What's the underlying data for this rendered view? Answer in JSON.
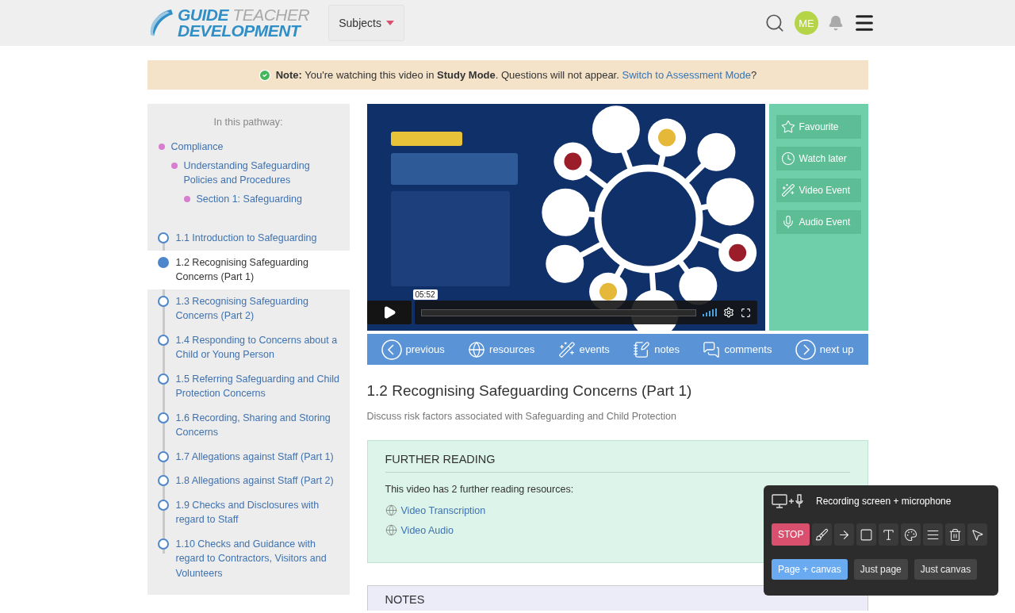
{
  "header": {
    "logo": {
      "word_1": "GUIDE",
      "word_2": "TEACHER",
      "word_3": "DEVELOPMENT"
    },
    "subjects_menu": "Subjects",
    "avatar": "ME"
  },
  "notice": {
    "text": "**Note:** You're watching this video in **Study Mode**. Questions will not appear.",
    "link": "Switch to Assessment Mode",
    "suffix": "?"
  },
  "pathway": {
    "title": "In this pathway:",
    "breadcrumbs": [
      {
        "label": "Compliance",
        "children": [
          {
            "label": "Understanding Safeguarding Policies and Procedures",
            "children": [
              {
                "label": "Section 1: Safeguarding"
              }
            ]
          }
        ]
      }
    ],
    "lessons": [
      {
        "label": "1.1 Introduction to Safeguarding",
        "selected": false
      },
      {
        "label": "1.2 Recognising Safeguarding Concerns (Part 1)",
        "selected": true
      },
      {
        "label": "1.3 Recognising Safeguarding Concerns (Part 2)",
        "selected": false
      },
      {
        "label": "1.4 Responding to Concerns about a Child or Young Person",
        "selected": false
      },
      {
        "label": "1.5 Referring Safeguarding and Child Protection Concerns",
        "selected": false
      },
      {
        "label": "1.6 Recording, Sharing and Storing Concerns",
        "selected": false
      },
      {
        "label": "1.7 Allegations against Staff (Part 1)",
        "selected": false
      },
      {
        "label": "1.8 Allegations against Staff (Part 2)",
        "selected": false
      },
      {
        "label": "1.9 Checks and Disclosures with regard to Staff",
        "selected": false
      },
      {
        "label": "1.10 Checks and Guidance with regard to Contractors, Visitors and Volunteers",
        "selected": false
      }
    ]
  },
  "video": {
    "kind": "picture",
    "time": "05:52",
    "level": 0
  },
  "video_actions": [
    {
      "kind": "star",
      "label": "Favourite"
    },
    {
      "kind": "clock",
      "label": "Watch later"
    },
    {
      "kind": "wand",
      "label": "Video Event"
    },
    {
      "kind": "mic",
      "label": "Audio Event"
    }
  ],
  "video_nav": [
    {
      "kind": "prev",
      "label": "previous"
    },
    {
      "kind": "globe",
      "label": "resources"
    },
    {
      "kind": "wand",
      "label": "events"
    },
    {
      "kind": "notepad",
      "label": "notes"
    },
    {
      "kind": "chat",
      "label": "comments"
    },
    {
      "kind": "next",
      "label": "next up"
    }
  ],
  "lesson": {
    "title": "1.2 Recognising Safeguarding Concerns (Part 1)",
    "description": "Discuss risk factors associated with Safeguarding and Child Protection"
  },
  "further_reading": {
    "heading": "FURTHER READING",
    "intro": "This video has 2 further reading resources:",
    "links": [
      "Video Transcription",
      "Video Audio"
    ]
  },
  "notes": {
    "heading": "NOTES"
  },
  "recorder": {
    "status": "Recording screen + microphone",
    "stop": "STOP",
    "tools": [
      {
        "kind": "brush"
      },
      {
        "kind": "arrow"
      },
      {
        "kind": "square"
      },
      {
        "kind": "text"
      },
      {
        "kind": "palette"
      },
      {
        "kind": "lines"
      },
      {
        "kind": "trash"
      },
      {
        "kind": "pointer"
      }
    ],
    "modes": [
      {
        "label": "Page + canvas",
        "selected": true
      },
      {
        "label": "Just page",
        "selected": false
      },
      {
        "label": "Just canvas",
        "selected": false
      }
    ]
  }
}
